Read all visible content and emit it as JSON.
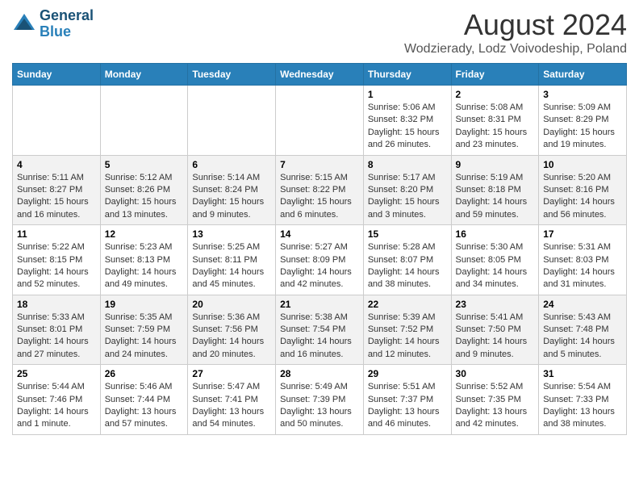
{
  "header": {
    "logo_line1": "General",
    "logo_line2": "Blue",
    "month": "August 2024",
    "location": "Wodzierady, Lodz Voivodeship, Poland"
  },
  "days_of_week": [
    "Sunday",
    "Monday",
    "Tuesday",
    "Wednesday",
    "Thursday",
    "Friday",
    "Saturday"
  ],
  "weeks": [
    [
      {
        "day": "",
        "info": ""
      },
      {
        "day": "",
        "info": ""
      },
      {
        "day": "",
        "info": ""
      },
      {
        "day": "",
        "info": ""
      },
      {
        "day": "1",
        "info": "Sunrise: 5:06 AM\nSunset: 8:32 PM\nDaylight: 15 hours and 26 minutes."
      },
      {
        "day": "2",
        "info": "Sunrise: 5:08 AM\nSunset: 8:31 PM\nDaylight: 15 hours and 23 minutes."
      },
      {
        "day": "3",
        "info": "Sunrise: 5:09 AM\nSunset: 8:29 PM\nDaylight: 15 hours and 19 minutes."
      }
    ],
    [
      {
        "day": "4",
        "info": "Sunrise: 5:11 AM\nSunset: 8:27 PM\nDaylight: 15 hours and 16 minutes."
      },
      {
        "day": "5",
        "info": "Sunrise: 5:12 AM\nSunset: 8:26 PM\nDaylight: 15 hours and 13 minutes."
      },
      {
        "day": "6",
        "info": "Sunrise: 5:14 AM\nSunset: 8:24 PM\nDaylight: 15 hours and 9 minutes."
      },
      {
        "day": "7",
        "info": "Sunrise: 5:15 AM\nSunset: 8:22 PM\nDaylight: 15 hours and 6 minutes."
      },
      {
        "day": "8",
        "info": "Sunrise: 5:17 AM\nSunset: 8:20 PM\nDaylight: 15 hours and 3 minutes."
      },
      {
        "day": "9",
        "info": "Sunrise: 5:19 AM\nSunset: 8:18 PM\nDaylight: 14 hours and 59 minutes."
      },
      {
        "day": "10",
        "info": "Sunrise: 5:20 AM\nSunset: 8:16 PM\nDaylight: 14 hours and 56 minutes."
      }
    ],
    [
      {
        "day": "11",
        "info": "Sunrise: 5:22 AM\nSunset: 8:15 PM\nDaylight: 14 hours and 52 minutes."
      },
      {
        "day": "12",
        "info": "Sunrise: 5:23 AM\nSunset: 8:13 PM\nDaylight: 14 hours and 49 minutes."
      },
      {
        "day": "13",
        "info": "Sunrise: 5:25 AM\nSunset: 8:11 PM\nDaylight: 14 hours and 45 minutes."
      },
      {
        "day": "14",
        "info": "Sunrise: 5:27 AM\nSunset: 8:09 PM\nDaylight: 14 hours and 42 minutes."
      },
      {
        "day": "15",
        "info": "Sunrise: 5:28 AM\nSunset: 8:07 PM\nDaylight: 14 hours and 38 minutes."
      },
      {
        "day": "16",
        "info": "Sunrise: 5:30 AM\nSunset: 8:05 PM\nDaylight: 14 hours and 34 minutes."
      },
      {
        "day": "17",
        "info": "Sunrise: 5:31 AM\nSunset: 8:03 PM\nDaylight: 14 hours and 31 minutes."
      }
    ],
    [
      {
        "day": "18",
        "info": "Sunrise: 5:33 AM\nSunset: 8:01 PM\nDaylight: 14 hours and 27 minutes."
      },
      {
        "day": "19",
        "info": "Sunrise: 5:35 AM\nSunset: 7:59 PM\nDaylight: 14 hours and 24 minutes."
      },
      {
        "day": "20",
        "info": "Sunrise: 5:36 AM\nSunset: 7:56 PM\nDaylight: 14 hours and 20 minutes."
      },
      {
        "day": "21",
        "info": "Sunrise: 5:38 AM\nSunset: 7:54 PM\nDaylight: 14 hours and 16 minutes."
      },
      {
        "day": "22",
        "info": "Sunrise: 5:39 AM\nSunset: 7:52 PM\nDaylight: 14 hours and 12 minutes."
      },
      {
        "day": "23",
        "info": "Sunrise: 5:41 AM\nSunset: 7:50 PM\nDaylight: 14 hours and 9 minutes."
      },
      {
        "day": "24",
        "info": "Sunrise: 5:43 AM\nSunset: 7:48 PM\nDaylight: 14 hours and 5 minutes."
      }
    ],
    [
      {
        "day": "25",
        "info": "Sunrise: 5:44 AM\nSunset: 7:46 PM\nDaylight: 14 hours and 1 minute."
      },
      {
        "day": "26",
        "info": "Sunrise: 5:46 AM\nSunset: 7:44 PM\nDaylight: 13 hours and 57 minutes."
      },
      {
        "day": "27",
        "info": "Sunrise: 5:47 AM\nSunset: 7:41 PM\nDaylight: 13 hours and 54 minutes."
      },
      {
        "day": "28",
        "info": "Sunrise: 5:49 AM\nSunset: 7:39 PM\nDaylight: 13 hours and 50 minutes."
      },
      {
        "day": "29",
        "info": "Sunrise: 5:51 AM\nSunset: 7:37 PM\nDaylight: 13 hours and 46 minutes."
      },
      {
        "day": "30",
        "info": "Sunrise: 5:52 AM\nSunset: 7:35 PM\nDaylight: 13 hours and 42 minutes."
      },
      {
        "day": "31",
        "info": "Sunrise: 5:54 AM\nSunset: 7:33 PM\nDaylight: 13 hours and 38 minutes."
      }
    ]
  ]
}
